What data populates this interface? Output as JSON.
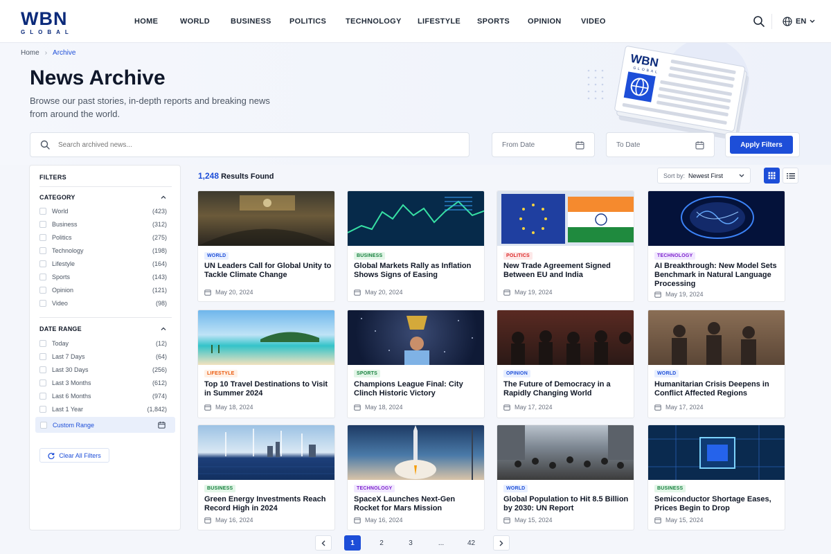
{
  "brand": {
    "logo_main": "WBN",
    "logo_sub": "GLOBAL",
    "illus_logo": "WBN",
    "illus_sub": "GLOBAL"
  },
  "nav": [
    "HOME",
    "WORLD",
    "BUSINESS",
    "POLITICS",
    "TECHNOLOGY",
    "LIFESTYLE",
    "SPORTS",
    "OPINION",
    "VIDEO"
  ],
  "header": {
    "language": "EN"
  },
  "breadcrumb": {
    "home": "Home",
    "current": "Archive"
  },
  "hero": {
    "title": "News Archive",
    "description": "Browse our past stories, in-depth reports and breaking news from around the world."
  },
  "search": {
    "placeholder": "Search archived news..."
  },
  "dates": {
    "from": "From Date",
    "to": "To Date"
  },
  "apply_label": "Apply Filters",
  "filters": {
    "title": "FILTERS",
    "category_title": "CATEGORY",
    "categories": [
      {
        "label": "World",
        "count": "(423)"
      },
      {
        "label": "Business",
        "count": "(312)"
      },
      {
        "label": "Politics",
        "count": "(275)"
      },
      {
        "label": "Technology",
        "count": "(198)"
      },
      {
        "label": "Lifestyle",
        "count": "(164)"
      },
      {
        "label": "Sports",
        "count": "(143)"
      },
      {
        "label": "Opinion",
        "count": "(121)"
      },
      {
        "label": "Video",
        "count": "(98)"
      }
    ],
    "date_title": "DATE RANGE",
    "dates": [
      {
        "label": "Today",
        "count": "(12)"
      },
      {
        "label": "Last 7 Days",
        "count": "(64)"
      },
      {
        "label": "Last 30 Days",
        "count": "(256)"
      },
      {
        "label": "Last 3 Months",
        "count": "(612)"
      },
      {
        "label": "Last 6 Months",
        "count": "(974)"
      },
      {
        "label": "Last 1 Year",
        "count": "(1,842)"
      }
    ],
    "custom_range": "Custom Range",
    "clear_label": "Clear All Filters"
  },
  "results": {
    "count": "1,248",
    "label": "Results Found"
  },
  "sort": {
    "prefix": "Sort by:",
    "value": "Newest First"
  },
  "colors": {
    "accent": "#1d4ed8",
    "brand": "#0b2a7a"
  },
  "articles": [
    {
      "tag": "WORLD",
      "title": "UN Leaders Call for Global Unity to Tackle Climate Change",
      "date": "May 20, 2024"
    },
    {
      "tag": "BUSINESS",
      "title": "Global Markets Rally as Inflation Shows Signs of Easing",
      "date": "May 20, 2024"
    },
    {
      "tag": "POLITICS",
      "title": "New Trade Agreement Signed Between EU and India",
      "date": "May 19, 2024"
    },
    {
      "tag": "TECHNOLOGY",
      "title": "AI Breakthrough: New Model Sets Benchmark in Natural Language Processing",
      "date": "May 19, 2024"
    },
    {
      "tag": "LIFESTYLE",
      "title": "Top 10 Travel Destinations to Visit in Summer 2024",
      "date": "May 18, 2024"
    },
    {
      "tag": "SPORTS",
      "title": "Champions League Final: City Clinch Historic Victory",
      "date": "May 18, 2024"
    },
    {
      "tag": "OPINION",
      "title": "The Future of Democracy in a Rapidly Changing World",
      "date": "May 17, 2024"
    },
    {
      "tag": "WORLD",
      "title": "Humanitarian Crisis Deepens in Conflict Affected Regions",
      "date": "May 17, 2024"
    },
    {
      "tag": "BUSINESS",
      "title": "Green Energy Investments Reach Record High in 2024",
      "date": "May 16, 2024"
    },
    {
      "tag": "TECHNOLOGY",
      "title": "SpaceX Launches Next-Gen Rocket for Mars Mission",
      "date": "May 16, 2024"
    },
    {
      "tag": "WORLD",
      "title": "Global Population to Hit 8.5 Billion by 2030: UN Report",
      "date": "May 15, 2024"
    },
    {
      "tag": "BUSINESS",
      "title": "Semiconductor Shortage Eases, Prices Begin to Drop",
      "date": "May 15, 2024"
    }
  ],
  "pagination": {
    "pages": [
      "1",
      "2",
      "3",
      "...",
      "42"
    ],
    "current": "1"
  }
}
